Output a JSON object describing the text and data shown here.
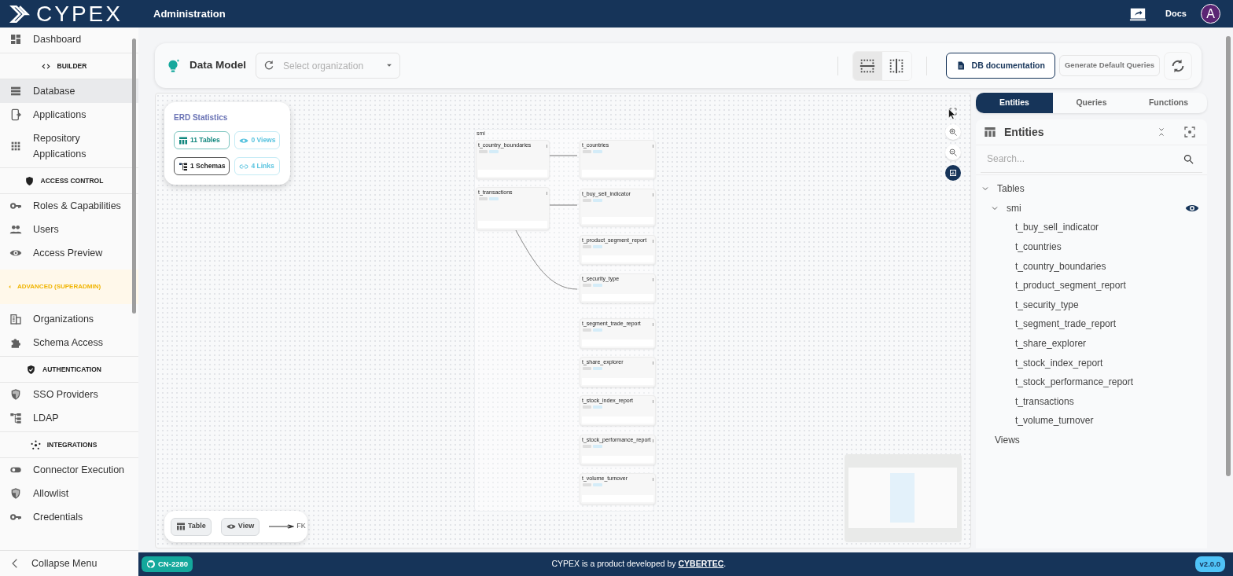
{
  "header": {
    "logo": "CYPEX",
    "title": "Administration",
    "docs": "Docs",
    "avatar": "A"
  },
  "sidebar": {
    "items": [
      {
        "kind": "item",
        "label": "Dashboard",
        "selected": false
      },
      {
        "kind": "section",
        "label": "BUILDER"
      },
      {
        "kind": "item",
        "label": "Database",
        "selected": true
      },
      {
        "kind": "item",
        "label": "Applications",
        "selected": false
      },
      {
        "kind": "item",
        "label": "Repository Applications",
        "selected": false
      },
      {
        "kind": "section",
        "label": "ACCESS CONTROL"
      },
      {
        "kind": "item",
        "label": "Roles & Capabilities",
        "selected": false
      },
      {
        "kind": "item",
        "label": "Users",
        "selected": false
      },
      {
        "kind": "item",
        "label": "Access Preview",
        "selected": false
      },
      {
        "kind": "warning",
        "label": "ADVANCED (SUPERADMIN)"
      },
      {
        "kind": "item",
        "label": "Organizations",
        "selected": false
      },
      {
        "kind": "item",
        "label": "Schema Access",
        "selected": false
      },
      {
        "kind": "section",
        "label": "AUTHENTICATION"
      },
      {
        "kind": "item",
        "label": "SSO Providers",
        "selected": false
      },
      {
        "kind": "item",
        "label": "LDAP",
        "selected": false
      },
      {
        "kind": "section",
        "label": "INTEGRATIONS"
      },
      {
        "kind": "item",
        "label": "Connector Execution",
        "selected": false
      },
      {
        "kind": "item",
        "label": "Allowlist",
        "selected": false
      },
      {
        "kind": "item",
        "label": "Credentials",
        "selected": false
      }
    ],
    "collapse": "Collapse Menu"
  },
  "toolbar": {
    "title": "Data Model",
    "organization": {
      "placeholder": "Select organization"
    },
    "layouts": [
      {
        "selected": true
      },
      {
        "selected": false
      }
    ],
    "doc_button": "DB documentation",
    "generate_button": "Generate Default Queries"
  },
  "erd": {
    "stats": {
      "title": "ERD Statistics",
      "badges": [
        {
          "kind": "tables",
          "label": "11 Tables"
        },
        {
          "kind": "views",
          "label": "0 Views"
        },
        {
          "kind": "schemas",
          "label": "1 Schemas"
        },
        {
          "kind": "links",
          "label": "4 Links"
        }
      ]
    },
    "schema": "smi",
    "tables": [
      {
        "name": "t_country_boundaries"
      },
      {
        "name": "t_countries"
      },
      {
        "name": "t_transactions"
      },
      {
        "name": "t_buy_sell_indicator"
      },
      {
        "name": "t_product_segment_report"
      },
      {
        "name": "t_security_type"
      },
      {
        "name": "t_segment_trade_report"
      },
      {
        "name": "t_share_explorer"
      },
      {
        "name": "t_stock_index_report"
      },
      {
        "name": "t_stock_performance_report"
      },
      {
        "name": "t_volume_turnover"
      }
    ],
    "legend": {
      "table": "Table",
      "view": "View",
      "fk": "FK"
    }
  },
  "panel": {
    "tabs": [
      {
        "label": "Entities",
        "selected": true
      },
      {
        "label": "Queries",
        "selected": false
      },
      {
        "label": "Functions",
        "selected": false
      }
    ],
    "title": "Entities",
    "search": {
      "placeholder": "Search..."
    },
    "tree": [
      {
        "label": "Tables",
        "expanded": true,
        "children": [
          {
            "label": "smi",
            "expanded": true,
            "children": [
              {
                "label": "t_buy_sell_indicator"
              },
              {
                "label": "t_countries"
              },
              {
                "label": "t_country_boundaries"
              },
              {
                "label": "t_product_segment_report"
              },
              {
                "label": "t_security_type"
              },
              {
                "label": "t_segment_trade_report"
              },
              {
                "label": "t_share_explorer"
              },
              {
                "label": "t_stock_index_report"
              },
              {
                "label": "t_stock_performance_report"
              },
              {
                "label": "t_transactions"
              },
              {
                "label": "t_volume_turnover"
              }
            ]
          }
        ]
      },
      {
        "label": "Views"
      }
    ]
  },
  "footer": {
    "badge": "CN-2280",
    "text": "CYPEX is a product developed by",
    "link": "CYBERTEC",
    "suffix": ".",
    "version": "v2.0.0"
  }
}
